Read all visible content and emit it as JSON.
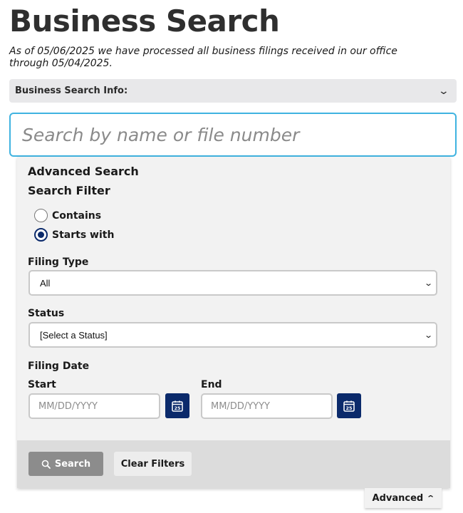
{
  "page": {
    "title": "Business Search",
    "subtitle": "As of 05/06/2025 we have processed all business filings received in our office through 05/04/2025."
  },
  "info_bar": {
    "label": "Business Search Info:",
    "icon": "chevron-down-icon"
  },
  "search": {
    "placeholder": "Search by name or file number",
    "value": ""
  },
  "advanced_panel": {
    "title": "Advanced Search",
    "filter_title": "Search Filter",
    "filter_options": [
      {
        "label": "Contains",
        "checked": false
      },
      {
        "label": "Starts with",
        "checked": true
      }
    ],
    "filing_type": {
      "label": "Filing Type",
      "selected": "All"
    },
    "status": {
      "label": "Status",
      "selected": "[Select a Status]"
    },
    "filing_date": {
      "label": "Filing Date",
      "start_label": "Start",
      "end_label": "End",
      "start_placeholder": "MM/DD/YYYY",
      "end_placeholder": "MM/DD/YYYY",
      "calendar_day": "25"
    },
    "buttons": {
      "search_label": "Search",
      "clear_label": "Clear Filters"
    }
  },
  "advanced_toggle": {
    "label": "Advanced",
    "icon": "chevron-up-icon"
  },
  "colors": {
    "accent_blue": "#3fb3e0",
    "navy": "#0b2a6b",
    "search_button": "#8c8c8c",
    "panel_bg": "#f2f2f2"
  }
}
